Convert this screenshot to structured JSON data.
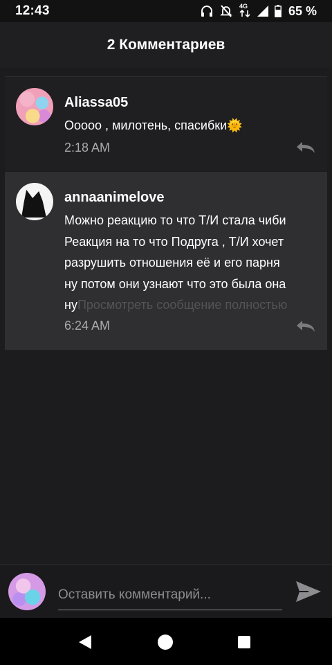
{
  "status_bar": {
    "time": "12:43",
    "network_label": "4G",
    "battery_percent": "65 %",
    "icons": [
      "headphones-icon",
      "mute-icon",
      "data-arrows-icon",
      "signal-icon",
      "battery-icon"
    ]
  },
  "header": {
    "title": "2 Комментариев"
  },
  "comments": [
    {
      "author": "Aliassa05",
      "text": "Ооооо , милотень, спасибки🌞",
      "time": "2:18 AM"
    },
    {
      "author": "annaanimelove",
      "text_lines": [
        "Можно реакцию то что Т/И стала чиби",
        "Реакция на то что Подруга , Т/И хочет",
        "разрушить отношения её и его парня",
        "ну потом они узнают что это была она",
        "ну"
      ],
      "read_more": "Просмотреть сообщение полностью",
      "time": "6:24 AM"
    }
  ],
  "compose": {
    "placeholder": "Оставить комментарий..."
  },
  "colors": {
    "background": "#1c1b1d",
    "highlighted_comment": "#2f2e31",
    "secondary_text": "#a9a8ab"
  }
}
